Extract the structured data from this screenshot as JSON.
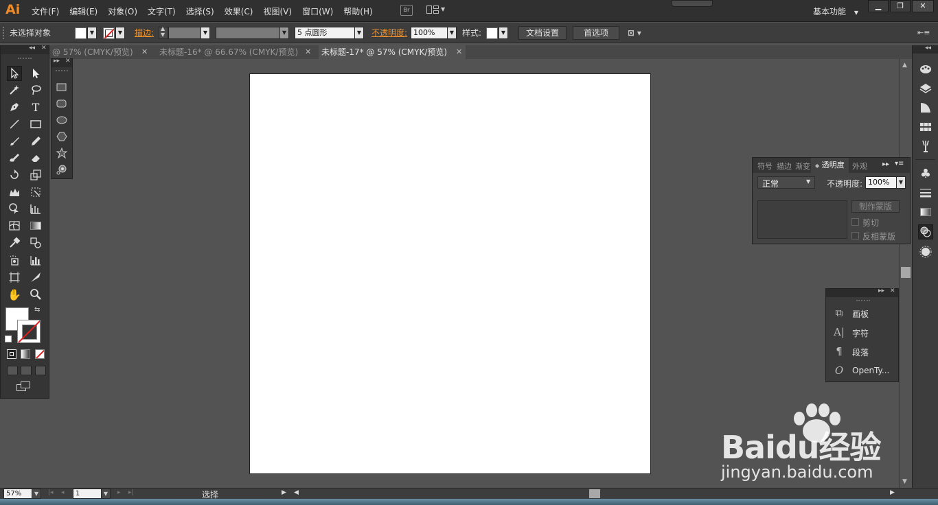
{
  "app": {
    "logo": "Ai",
    "menus": [
      "文件(F)",
      "编辑(E)",
      "对象(O)",
      "文字(T)",
      "选择(S)",
      "效果(C)",
      "视图(V)",
      "窗口(W)",
      "帮助(H)"
    ],
    "bridge_label": "Br",
    "workspace": "基本功能",
    "window_buttons": [
      "▁",
      "❐",
      "✕"
    ]
  },
  "control": {
    "selection_label": "未选择对象",
    "stroke_label": "描边:",
    "stroke_width": "",
    "brush_value": "",
    "point_label": "5 点圆形",
    "opacity_label": "不透明度:",
    "opacity_value": "100%",
    "style_label": "样式:",
    "doc_setup": "文档设置",
    "preferences": "首选项"
  },
  "tabs": [
    {
      "label": "@ 57% (CMYK/预览)",
      "active": false
    },
    {
      "label": "未标题-16* @ 66.67% (CMYK/预览)",
      "active": false
    },
    {
      "label": "未标题-17* @ 57% (CMYK/预览)",
      "active": true
    }
  ],
  "tools": [
    "selection-tool",
    "direct-selection-tool",
    "magic-wand-tool",
    "lasso-tool",
    "pen-tool",
    "type-tool",
    "line-segment-tool",
    "rectangle-tool",
    "paintbrush-tool",
    "pencil-tool",
    "blob-brush-tool",
    "eraser-tool",
    "rotate-tool",
    "scale-tool",
    "width-tool",
    "free-transform-tool",
    "shape-builder-tool",
    "perspective-grid-tool",
    "mesh-tool",
    "gradient-tool",
    "eyedropper-tool",
    "blend-tool",
    "symbol-sprayer-tool",
    "column-graph-tool",
    "artboard-tool",
    "slice-tool",
    "hand-tool",
    "zoom-tool"
  ],
  "status": {
    "zoom": "57%",
    "artboard_num": "1",
    "tool_name": "选择"
  },
  "transparency_panel": {
    "tabs": [
      "符号",
      "描边",
      "渐变",
      "透明度",
      "外观"
    ],
    "blend_mode": "正常",
    "opacity_label": "不透明度:",
    "opacity_value": "100%",
    "make_mask": "制作蒙版",
    "clip": "剪切",
    "invert_mask": "反相蒙版"
  },
  "char_panel": {
    "items": [
      {
        "label": "画板",
        "icon": "artboards-icon"
      },
      {
        "label": "字符",
        "icon": "character-icon"
      },
      {
        "label": "段落",
        "icon": "paragraph-icon"
      },
      {
        "label": "OpenTy...",
        "icon": "opentype-icon"
      }
    ]
  },
  "watermark": {
    "brand": "Baidu经验",
    "url": "jingyan.baidu.com"
  }
}
